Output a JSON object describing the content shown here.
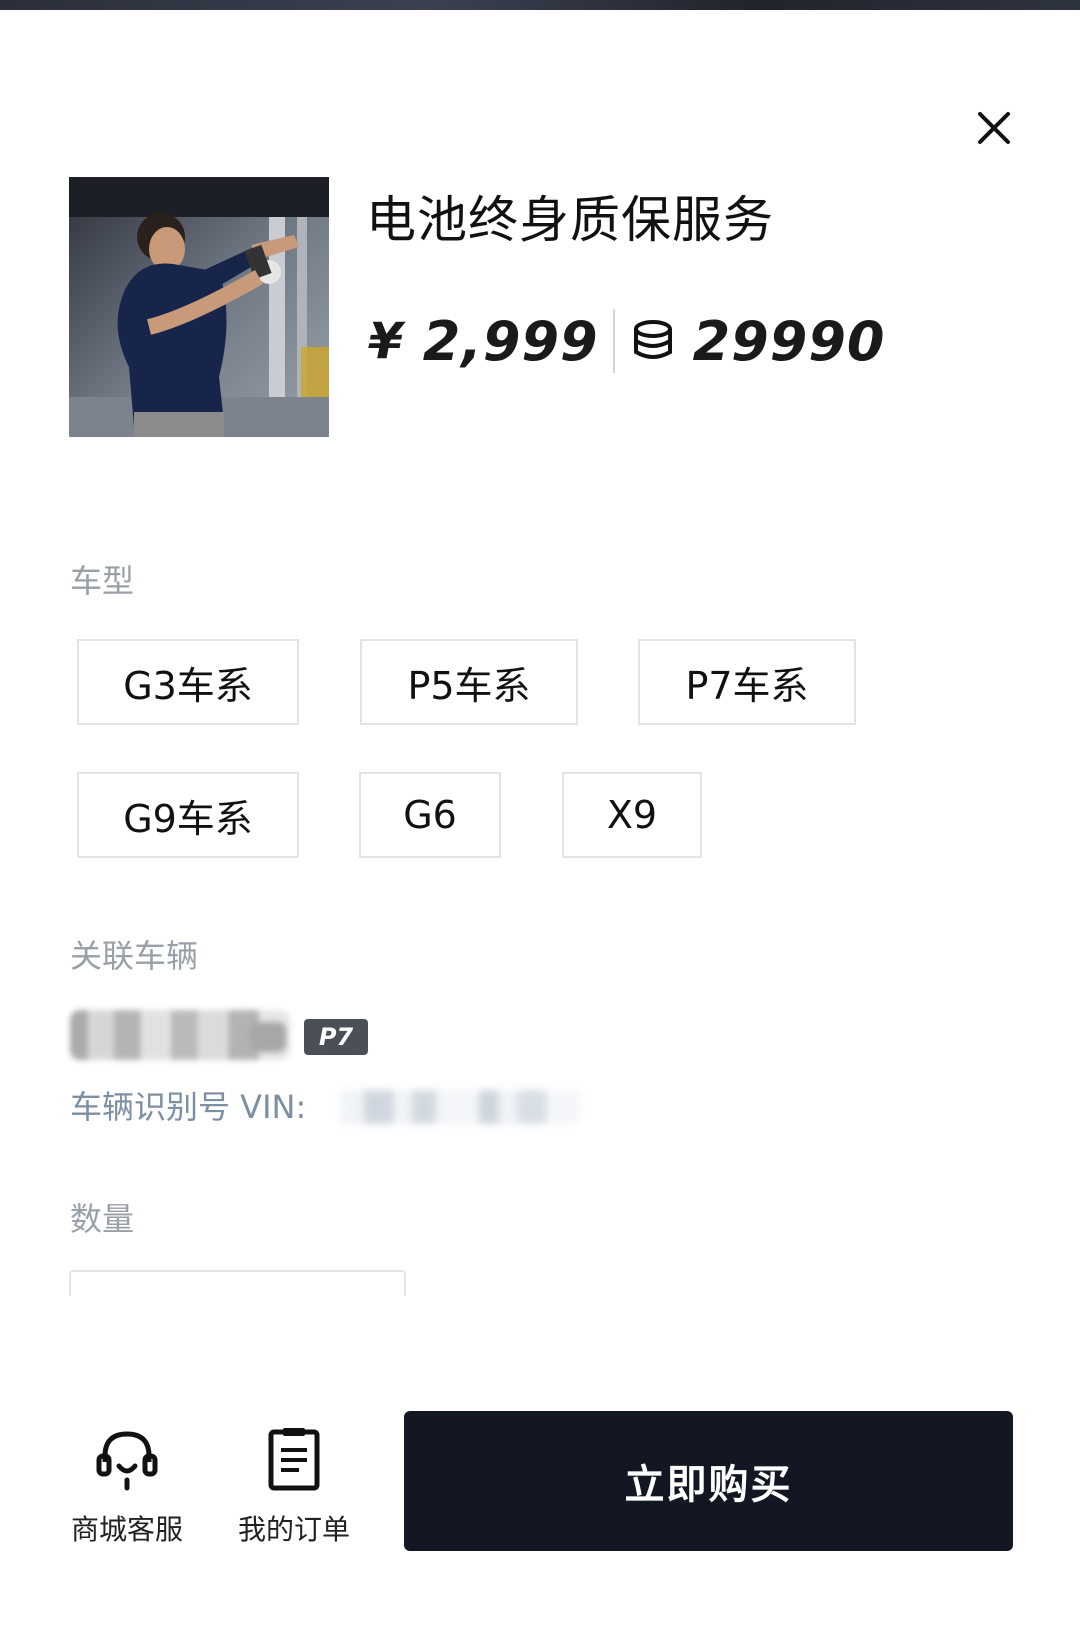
{
  "product": {
    "title": "电池终身质保服务",
    "price_currency": "¥",
    "price": "2,999",
    "points": "29990"
  },
  "icons": {
    "close": "close-icon",
    "coin": "coin-stack-icon",
    "service": "headset-icon",
    "orders": "clipboard-icon"
  },
  "model_section": {
    "label": "车型",
    "options": [
      {
        "label": "G3车系"
      },
      {
        "label": "P5车系"
      },
      {
        "label": "P7车系"
      },
      {
        "label": "G9车系"
      },
      {
        "label": "G6"
      },
      {
        "label": "X9"
      }
    ]
  },
  "vehicle_section": {
    "label": "关联车辆",
    "badge": "P7",
    "vin_label": "车辆识别号 VIN:"
  },
  "quantity_section": {
    "label": "数量"
  },
  "footer": {
    "service_label": "商城客服",
    "orders_label": "我的订单",
    "buy_label": "立即购买"
  },
  "colors": {
    "buy_button": "#131723",
    "label_gray": "#9aa0a8",
    "vin_blue_gray": "#7d8fa3",
    "badge_bg": "#4b4f57"
  }
}
